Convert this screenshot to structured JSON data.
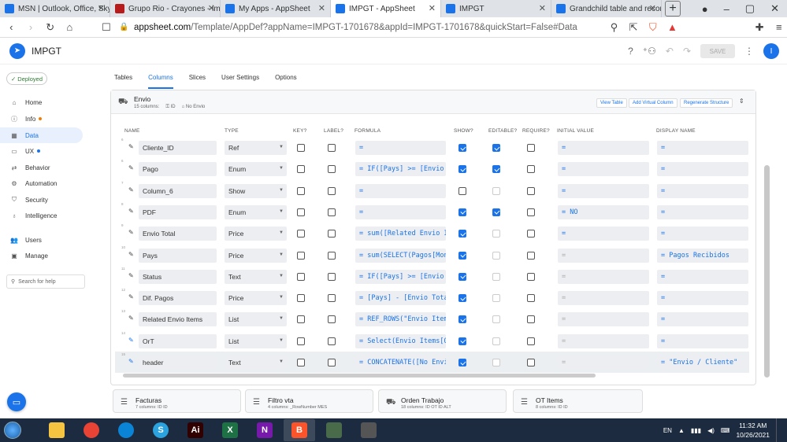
{
  "browser": {
    "tabs": [
      {
        "title": "MSN | Outlook, Office, Skype",
        "color": "#1a73e8"
      },
      {
        "title": "Grupo Rio - Crayones - impre",
        "color": "#b71c1c"
      },
      {
        "title": "My Apps - AppSheet",
        "color": "#1a73e8"
      },
      {
        "title": "IMPGT - AppSheet",
        "color": "#1a73e8",
        "active": true
      },
      {
        "title": "IMPGT",
        "color": "#1a73e8"
      },
      {
        "title": "Grandchild table and record",
        "color": "#1a73e8"
      }
    ],
    "new_tab": "+",
    "url_domain": "appsheet.com",
    "url_rest": "/Template/AppDef?appName=IMPGT-1701678&appId=IMPGT-1701678&quickStart=False#Data.Columns.Envi..."
  },
  "app": {
    "name": "IMPGT",
    "save_label": "SAVE",
    "avatar": "I"
  },
  "sidebar": {
    "deployed": "Deployed",
    "items": [
      {
        "label": "Home",
        "icon": "home-icon",
        "glyph": "⌂"
      },
      {
        "label": "Info",
        "icon": "info-icon",
        "glyph": "ⓘ",
        "dot": "#f57c00"
      },
      {
        "label": "Data",
        "icon": "data-icon",
        "glyph": "▦",
        "selected": true
      },
      {
        "label": "UX",
        "icon": "ux-icon",
        "glyph": "▭",
        "dot": "#1a73e8"
      },
      {
        "label": "Behavior",
        "icon": "behavior-icon",
        "glyph": "⇄"
      },
      {
        "label": "Automation",
        "icon": "automation-icon",
        "glyph": "⚙"
      },
      {
        "label": "Security",
        "icon": "security-icon",
        "glyph": "⛉"
      },
      {
        "label": "Intelligence",
        "icon": "intelligence-icon",
        "glyph": "♁"
      },
      {
        "label": "Users",
        "icon": "users-icon",
        "glyph": "👥"
      },
      {
        "label": "Manage",
        "icon": "manage-icon",
        "glyph": "▣"
      }
    ],
    "search_help": "Search for help"
  },
  "main_tabs": [
    "Tables",
    "Columns",
    "Slices",
    "User Settings",
    "Options"
  ],
  "table": {
    "name": "Envio",
    "columns_count": "15 columns:",
    "key": "ID",
    "label": "No Envio",
    "buttons": [
      "View Table",
      "Add Virtual Column",
      "Regenerate Structure"
    ],
    "headers": [
      "NAME",
      "TYPE",
      "KEY?",
      "LABEL?",
      "FORMULA",
      "SHOW?",
      "EDITABLE?",
      "REQUIRE?",
      "INITIAL VALUE",
      "DISPLAY NAME"
    ],
    "rows": [
      {
        "num": "6",
        "name": "Cliente_ID",
        "type": "Ref",
        "key": false,
        "label": false,
        "formula": "=",
        "show": true,
        "editable": true,
        "editable_dis": false,
        "require": false,
        "initial": "=",
        "initial_dim": false,
        "display": "=",
        "pencil_blue": false
      },
      {
        "num": "6",
        "name": "Pago",
        "type": "Enum",
        "key": false,
        "label": false,
        "formula": "= IF([Pays] >= [Envio T",
        "show": true,
        "editable": true,
        "editable_dis": false,
        "require": false,
        "initial": "=",
        "initial_dim": false,
        "display": "=",
        "pencil_blue": false
      },
      {
        "num": "7",
        "name": "Column_6",
        "type": "Show",
        "key": false,
        "label": false,
        "formula": "=",
        "show": false,
        "editable": false,
        "editable_dis": true,
        "require": false,
        "initial": "=",
        "initial_dim": false,
        "display": "=",
        "pencil_blue": false
      },
      {
        "num": "8",
        "name": "PDF",
        "type": "Enum",
        "key": false,
        "label": false,
        "formula": "=",
        "show": true,
        "editable": true,
        "editable_dis": false,
        "require": false,
        "initial": "= NO",
        "initial_dim": false,
        "display": "=",
        "pencil_blue": false
      },
      {
        "num": "9",
        "name": "Envio Total",
        "type": "Price",
        "key": false,
        "label": false,
        "formula": "= sum([Related Envio It",
        "show": true,
        "editable": false,
        "editable_dis": true,
        "require": false,
        "initial": "=",
        "initial_dim": false,
        "display": "=",
        "pencil_blue": false
      },
      {
        "num": "10",
        "name": "Pays",
        "type": "Price",
        "key": false,
        "label": false,
        "formula": "= sum(SELECT(Pagos[Mont",
        "show": true,
        "editable": false,
        "editable_dis": true,
        "require": false,
        "initial": "=",
        "initial_dim": true,
        "display": "= Pagos Recibidos",
        "pencil_blue": false
      },
      {
        "num": "11",
        "name": "Status",
        "type": "Text",
        "key": false,
        "label": false,
        "formula": "= IF([Pays] >= [Envio T",
        "show": true,
        "editable": false,
        "editable_dis": true,
        "require": false,
        "initial": "=",
        "initial_dim": true,
        "display": "=",
        "pencil_blue": false
      },
      {
        "num": "12",
        "name": "Dif. Pagos",
        "type": "Price",
        "key": false,
        "label": false,
        "formula": "= [Pays] - [Envio Total",
        "show": true,
        "editable": false,
        "editable_dis": true,
        "require": false,
        "initial": "=",
        "initial_dim": true,
        "display": "=",
        "pencil_blue": false
      },
      {
        "num": "13",
        "name": "Related Envio Items",
        "type": "List",
        "key": false,
        "label": false,
        "formula": "= REF_ROWS(\"Envio Items",
        "show": true,
        "editable": false,
        "editable_dis": true,
        "require": false,
        "initial": "=",
        "initial_dim": true,
        "display": "=",
        "pencil_blue": false
      },
      {
        "num": "14",
        "name": "OrT",
        "type": "List",
        "key": false,
        "label": false,
        "formula": "= Select(Envio Items[OT",
        "show": true,
        "editable": false,
        "editable_dis": true,
        "require": false,
        "initial": "=",
        "initial_dim": true,
        "display": "=",
        "pencil_blue": true
      },
      {
        "num": "15",
        "name": "header",
        "type": "Text",
        "key": false,
        "label": false,
        "formula": "= CONCATENATE([No Envio",
        "show": true,
        "editable": false,
        "editable_dis": true,
        "require": false,
        "initial": "=",
        "initial_dim": true,
        "display": "= \"Envio / Cliente\"",
        "pencil_blue": true,
        "highlight": true
      }
    ]
  },
  "bottom_tables": [
    {
      "name": "Facturas",
      "meta": "7 columns:  ID   ID",
      "icon": "table-icon"
    },
    {
      "name": "Filtro vta",
      "meta": "4 columns:  _RowNumber   MES",
      "icon": "table-icon"
    },
    {
      "name": "Orden Trabajo",
      "meta": "18 columns:  ID   OT ID ALT",
      "icon": "truck-icon"
    },
    {
      "name": "OT Items",
      "meta": "8 columns:  ID   ID",
      "icon": "list-icon"
    }
  ],
  "taskbar": {
    "apps": [
      {
        "label": "",
        "color": "#f5c542",
        "icon": "explorer-icon"
      },
      {
        "label": "",
        "color": "#e84335",
        "icon": "chrome-icon"
      },
      {
        "label": "",
        "color": "#0a84d6",
        "icon": "edge-icon"
      },
      {
        "label": "S",
        "color": "#2aa3de",
        "icon": "skype-icon"
      },
      {
        "label": "Ai",
        "color": "#310000",
        "icon": "illustrator-icon"
      },
      {
        "label": "X",
        "color": "#1e7145",
        "icon": "excel-icon"
      },
      {
        "label": "N",
        "color": "#7719aa",
        "icon": "onenote-icon"
      },
      {
        "label": "B",
        "color": "#fb542b",
        "icon": "brave-icon",
        "selected": true
      },
      {
        "label": "",
        "color": "#4a6b4a",
        "icon": "monitor-icon"
      },
      {
        "label": "",
        "color": "#555555",
        "icon": "printer-icon"
      }
    ],
    "lang": "EN",
    "time": "11:32 AM",
    "date": "10/26/2021"
  }
}
